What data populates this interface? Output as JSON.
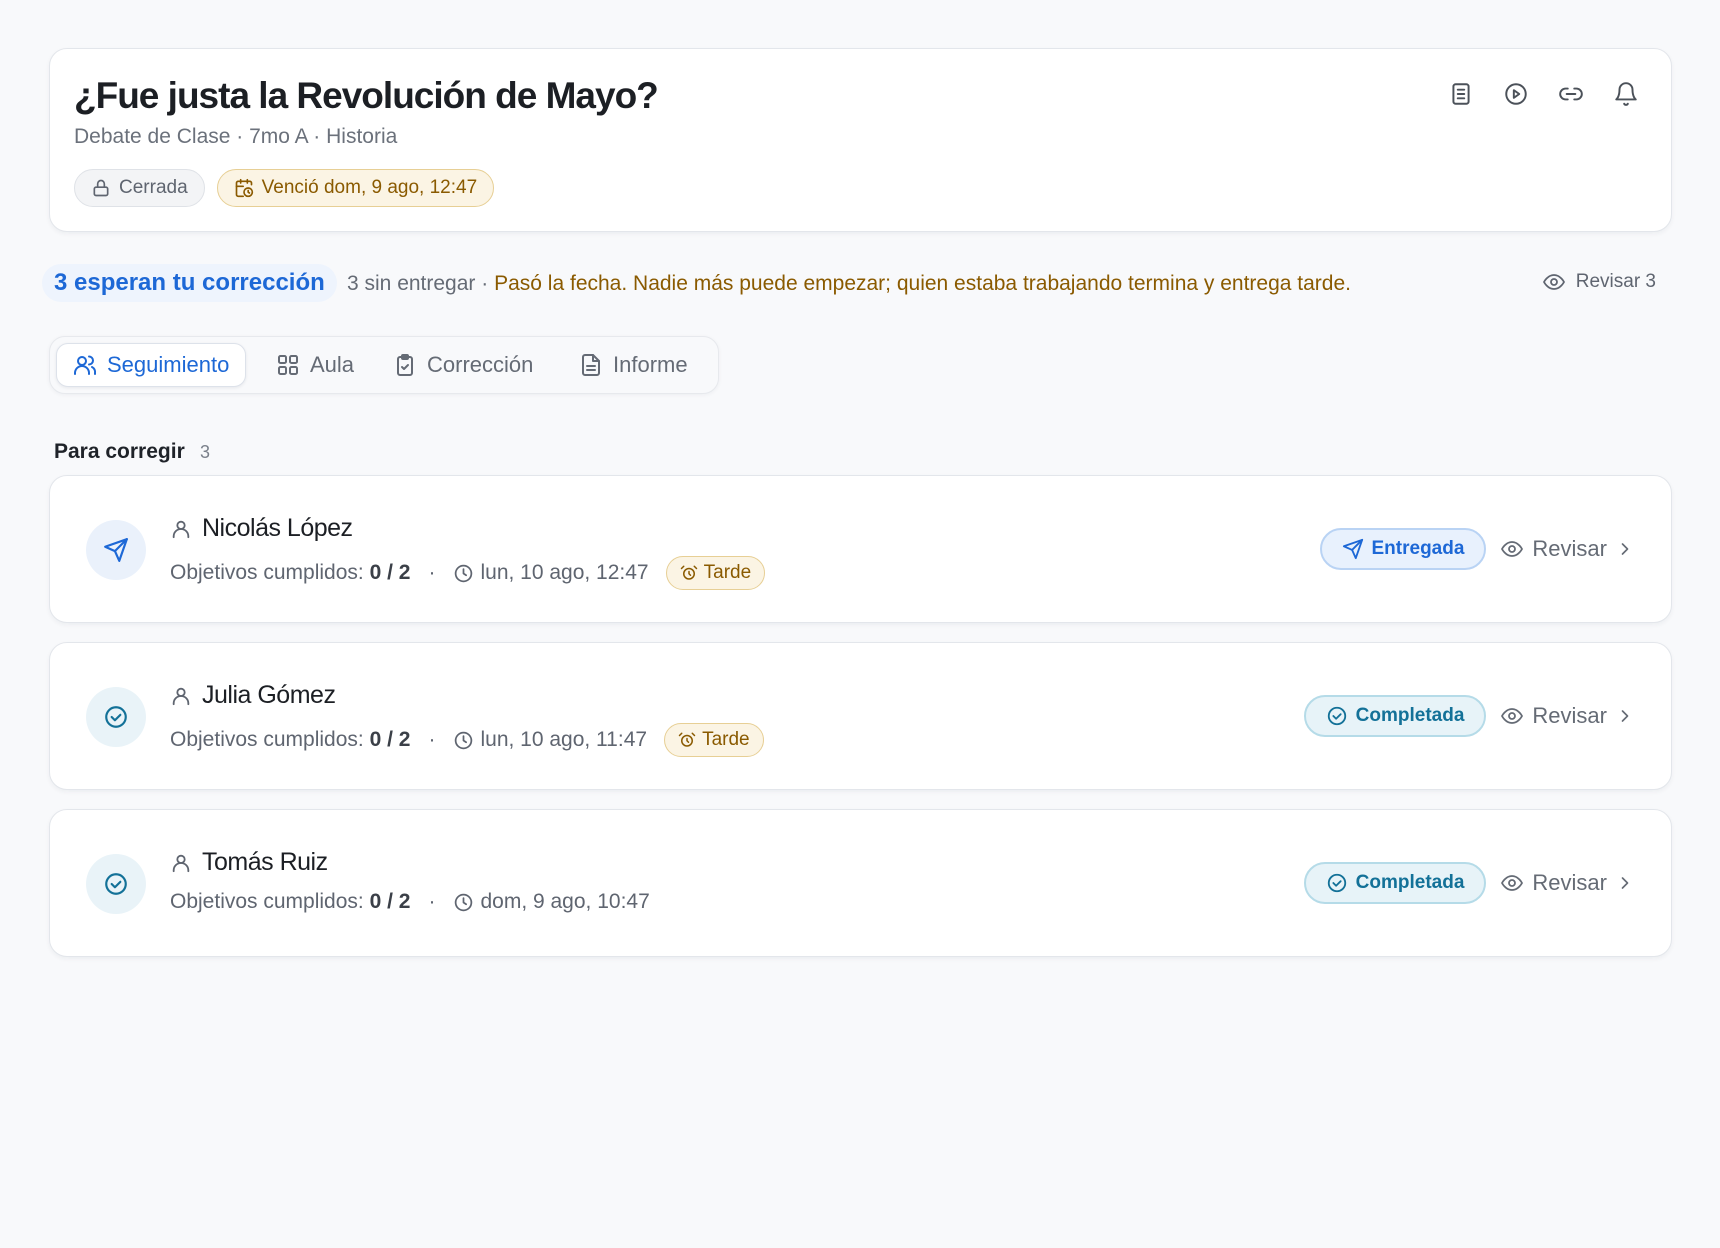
{
  "header": {
    "title": "¿Fue justa la Revolución de Mayo?",
    "subtitle": "Debate de Clase · 7mo A · Historia",
    "status_chip": "Cerrada",
    "due_chip": "Venció dom, 9 ago, 12:47",
    "actions": [
      "document-icon",
      "play-icon",
      "link-icon",
      "bell-icon"
    ]
  },
  "status": {
    "awaiting": "3 esperan tu corrección",
    "missing": "3 sin entregar",
    "separator": "·",
    "warning": "Pasó la fecha. Nadie más puede empezar; quien estaba trabajando termina y entrega tarde.",
    "review_all": "Revisar 3"
  },
  "tabs": [
    {
      "label": "Seguimiento",
      "icon": "users-icon",
      "active": true
    },
    {
      "label": "Aula",
      "icon": "grid-icon",
      "active": false
    },
    {
      "label": "Corrección",
      "icon": "clipboard-check-icon",
      "active": false
    },
    {
      "label": "Informe",
      "icon": "file-text-icon",
      "active": false
    }
  ],
  "section": {
    "label": "Para corregir",
    "count": "3"
  },
  "students": [
    {
      "name": "Nicolás López",
      "objectives_label": "Objetivos cumplidos:",
      "objectives_value": "0 / 2",
      "dot": "·",
      "time": "lun, 10 ago, 12:47",
      "late": "Tarde",
      "status": "Entregada",
      "status_icon": "send-icon",
      "review": "Revisar"
    },
    {
      "name": "Julia Gómez",
      "objectives_label": "Objetivos cumplidos:",
      "objectives_value": "0 / 2",
      "dot": "·",
      "time": "lun, 10 ago, 11:47",
      "late": "Tarde",
      "status": "Completada",
      "status_icon": "check-circle-icon",
      "review": "Revisar"
    },
    {
      "name": "Tomás Ruiz",
      "objectives_label": "Objetivos cumplidos:",
      "objectives_value": "0 / 2",
      "dot": "·",
      "time": "dom, 9 ago, 10:47",
      "late": null,
      "status": "Completada",
      "status_icon": "check-circle-icon",
      "review": "Revisar"
    }
  ],
  "colors": {
    "accent_blue": "#1d68d6",
    "warning_amber": "#8a5a00",
    "completed_teal": "#137198",
    "background": "#f8f9fb"
  }
}
